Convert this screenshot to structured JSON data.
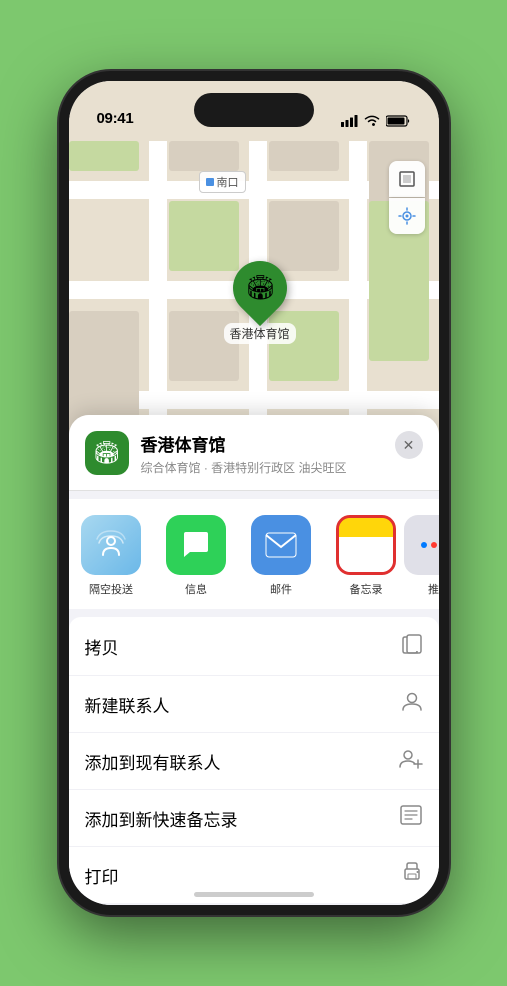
{
  "status_bar": {
    "time": "09:41",
    "location_icon": "▶"
  },
  "map": {
    "label_text": "南口",
    "marker_label": "香港体育馆",
    "marker_emoji": "🏟"
  },
  "place_header": {
    "name": "香港体育馆",
    "subtitle": "综合体育馆 · 香港特别行政区 油尖旺区",
    "close_label": "✕"
  },
  "share_items": [
    {
      "id": "airdrop",
      "label": "隔空投送",
      "icon": "📡"
    },
    {
      "id": "messages",
      "label": "信息",
      "icon": "💬"
    },
    {
      "id": "mail",
      "label": "邮件",
      "icon": "✉️"
    },
    {
      "id": "notes",
      "label": "备忘录",
      "icon": "📝",
      "selected": true
    },
    {
      "id": "more",
      "label": "推",
      "icon": "···"
    }
  ],
  "action_items": [
    {
      "id": "copy",
      "label": "拷贝",
      "icon": "📋"
    },
    {
      "id": "new-contact",
      "label": "新建联系人",
      "icon": "👤"
    },
    {
      "id": "add-contact",
      "label": "添加到现有联系人",
      "icon": "👤+"
    },
    {
      "id": "quick-note",
      "label": "添加到新快速备忘录",
      "icon": "📝"
    },
    {
      "id": "print",
      "label": "打印",
      "icon": "🖨"
    }
  ],
  "colors": {
    "green_accent": "#2e8b2e",
    "selected_border": "#e03030",
    "notes_yellow": "#FFD60A"
  }
}
